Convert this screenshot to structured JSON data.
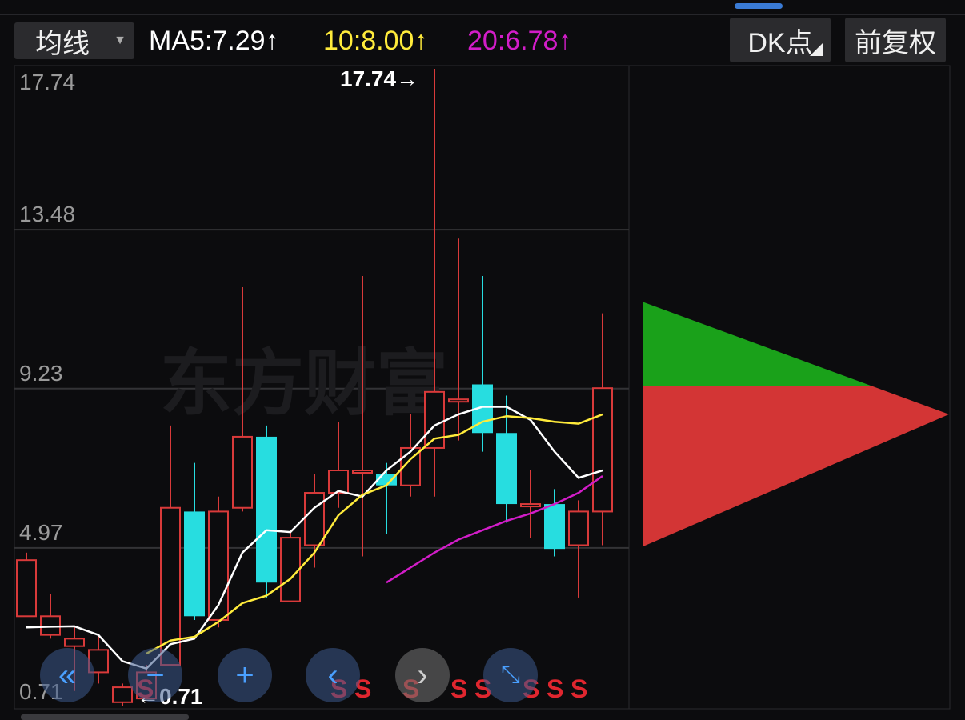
{
  "toolbar": {
    "ma_select": "均线",
    "ma5": "MA5:7.29",
    "ma10": "10:8.00",
    "ma20": "20:6.78",
    "up_arrow": "↑",
    "dk_button": "DK点",
    "adjust_button": "前复权"
  },
  "colors": {
    "up": "#d93a3a",
    "down": "#27dde0",
    "ma5": "#ffffff",
    "ma10": "#ffeb3b",
    "ma20": "#d21dc8",
    "profile_upper": "#1aa11a",
    "profile_lower": "#d33535"
  },
  "watermark": "东方财富",
  "markers": {
    "high": "17.74",
    "low": "0.71"
  },
  "signals": [
    "S",
    "S",
    "S",
    "S",
    "S",
    "S",
    "S",
    "S",
    "S"
  ],
  "chart_data": {
    "type": "candlestick",
    "y_ticks": [
      "17.74",
      "13.48",
      "9.23",
      "4.97",
      "0.71"
    ],
    "ylim": [
      0.71,
      17.74
    ],
    "grid": true,
    "candles": [
      {
        "o": 3.1,
        "c": 4.6,
        "h": 4.8,
        "l": 3.1
      },
      {
        "o": 2.6,
        "c": 3.1,
        "h": 3.7,
        "l": 2.5
      },
      {
        "o": 2.3,
        "c": 2.5,
        "h": 2.8,
        "l": 1.1
      },
      {
        "o": 1.6,
        "c": 2.2,
        "h": 2.6,
        "l": 1.3
      },
      {
        "o": 0.8,
        "c": 1.2,
        "h": 1.3,
        "l": 0.71
      },
      {
        "o": 0.9,
        "c": 1.6,
        "h": 1.8,
        "l": 0.9
      },
      {
        "o": 1.8,
        "c": 6.0,
        "h": 8.2,
        "l": 1.8
      },
      {
        "o": 5.9,
        "c": 3.1,
        "h": 7.2,
        "l": 3.0
      },
      {
        "o": 3.0,
        "c": 5.9,
        "h": 6.3,
        "l": 2.8
      },
      {
        "o": 6.0,
        "c": 7.9,
        "h": 11.9,
        "l": 5.9
      },
      {
        "o": 7.9,
        "c": 4.0,
        "h": 8.2,
        "l": 3.6
      },
      {
        "o": 3.5,
        "c": 5.2,
        "h": 5.4,
        "l": 3.5
      },
      {
        "o": 5.0,
        "c": 6.4,
        "h": 6.9,
        "l": 4.4
      },
      {
        "o": 6.4,
        "c": 7.0,
        "h": 8.3,
        "l": 6.0
      },
      {
        "o": 7.0,
        "c": 7.0,
        "h": 12.2,
        "l": 4.7
      },
      {
        "o": 6.9,
        "c": 6.6,
        "h": 7.2,
        "l": 5.3
      },
      {
        "o": 6.6,
        "c": 7.6,
        "h": 8.5,
        "l": 6.3
      },
      {
        "o": 7.6,
        "c": 9.1,
        "h": 17.74,
        "l": 6.3
      },
      {
        "o": 8.9,
        "c": 8.9,
        "h": 13.2,
        "l": 7.8
      },
      {
        "o": 9.3,
        "c": 8.0,
        "h": 12.2,
        "l": 7.5
      },
      {
        "o": 8.0,
        "c": 6.1,
        "h": 9.0,
        "l": 5.6
      },
      {
        "o": 6.1,
        "c": 6.1,
        "h": 7.0,
        "l": 5.2
      },
      {
        "o": 6.1,
        "c": 4.9,
        "h": 6.5,
        "l": 4.7
      },
      {
        "o": 5.0,
        "c": 5.9,
        "h": 6.2,
        "l": 3.6
      },
      {
        "o": 5.9,
        "c": 9.2,
        "h": 11.2,
        "l": 5.0
      }
    ],
    "series": [
      {
        "name": "MA5",
        "values": [
          2.8,
          2.82,
          2.83,
          2.6,
          1.9,
          1.7,
          2.35,
          2.5,
          3.4,
          4.8,
          5.4,
          5.35,
          6.0,
          6.45,
          6.3,
          7.0,
          7.5,
          8.2,
          8.5,
          8.7,
          8.7,
          8.35,
          7.5,
          6.8,
          7.0
        ]
      },
      {
        "name": "MA10",
        "values": [
          null,
          null,
          null,
          null,
          null,
          2.1,
          2.45,
          2.55,
          2.95,
          3.45,
          3.65,
          4.1,
          4.8,
          5.8,
          6.35,
          6.6,
          7.3,
          7.85,
          7.95,
          8.3,
          8.45,
          8.4,
          8.3,
          8.25,
          8.5
        ]
      },
      {
        "name": "MA20",
        "values": [
          null,
          null,
          null,
          null,
          null,
          null,
          null,
          null,
          null,
          null,
          null,
          null,
          null,
          null,
          null,
          4.0,
          4.4,
          4.8,
          5.15,
          5.4,
          5.65,
          5.85,
          6.1,
          6.4,
          6.85
        ]
      }
    ],
    "signal_candles": [
      13,
      14,
      16,
      18,
      19,
      21,
      22,
      23
    ],
    "chip_profile": {
      "price_range": [
        4.97,
        11.5
      ],
      "peak_price": 8.5,
      "split_price": 9.25
    }
  }
}
